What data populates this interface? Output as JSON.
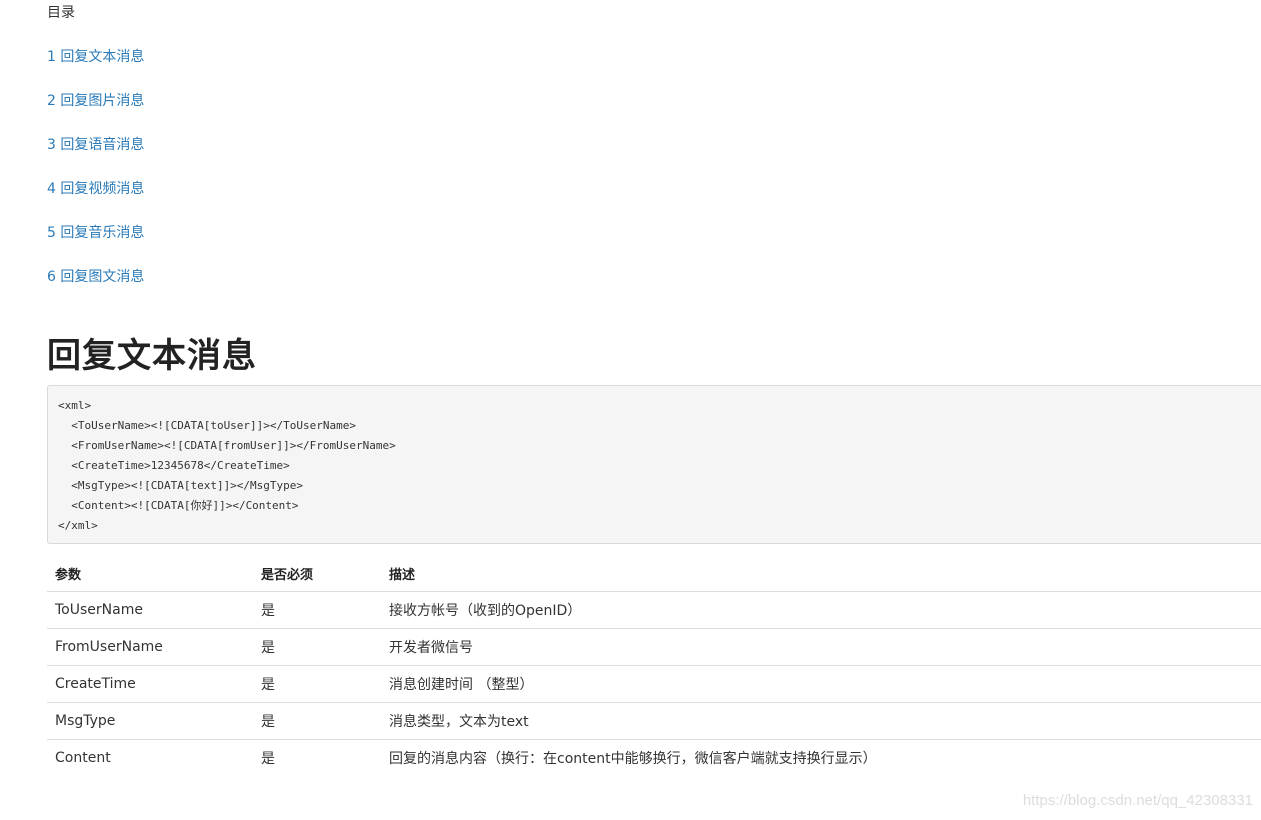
{
  "toc": {
    "title": "目录",
    "items": [
      {
        "label": "1 回复文本消息"
      },
      {
        "label": "2 回复图片消息"
      },
      {
        "label": "3 回复语音消息"
      },
      {
        "label": "4 回复视频消息"
      },
      {
        "label": "5 回复音乐消息"
      },
      {
        "label": "6 回复图文消息"
      }
    ]
  },
  "section": {
    "heading": "回复文本消息"
  },
  "code": {
    "lines": [
      "<xml>",
      "  <ToUserName><![CDATA[toUser]]></ToUserName>",
      "  <FromUserName><![CDATA[fromUser]]></FromUserName>",
      "  <CreateTime>12345678</CreateTime>",
      "  <MsgType><![CDATA[text]]></MsgType>",
      "  <Content><![CDATA[你好]]></Content>",
      "</xml>"
    ]
  },
  "table": {
    "headers": {
      "param": "参数",
      "required": "是否必须",
      "desc": "描述"
    },
    "rows": [
      {
        "param": "ToUserName",
        "required": "是",
        "desc": "接收方帐号（收到的OpenID）"
      },
      {
        "param": "FromUserName",
        "required": "是",
        "desc": "开发者微信号"
      },
      {
        "param": "CreateTime",
        "required": "是",
        "desc": "消息创建时间 （整型）"
      },
      {
        "param": "MsgType",
        "required": "是",
        "desc": "消息类型，文本为text"
      },
      {
        "param": "Content",
        "required": "是",
        "desc": "回复的消息内容（换行：在content中能够换行，微信客户端就支持换行显示）"
      }
    ]
  },
  "watermark": "https://blog.csdn.net/qq_42308331",
  "colors": {
    "link": "#2a7ab8",
    "code_bg": "#f5f5f5"
  }
}
